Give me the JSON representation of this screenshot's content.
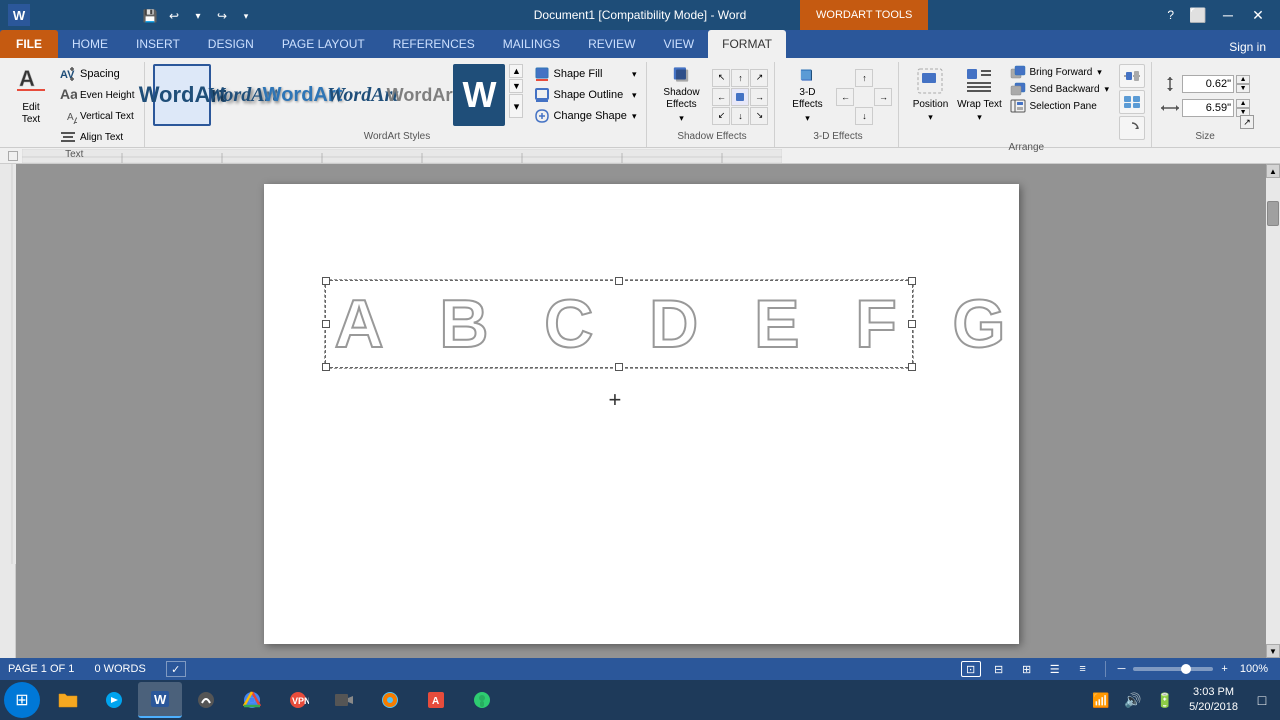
{
  "window": {
    "title": "Document1 [Compatibility Mode] - Word",
    "wordart_tools_label": "WORDART TOOLS",
    "sign_in": "Sign in"
  },
  "title_controls": {
    "help": "?",
    "restore": "❐",
    "minimize": "─",
    "close": "✕"
  },
  "quick_access": {
    "save": "💾",
    "undo": "↩",
    "redo": "↪",
    "more": "▾"
  },
  "ribbon_tabs": {
    "file": "FILE",
    "home": "HOME",
    "insert": "INSERT",
    "design": "DESIGN",
    "page_layout": "PAGE LAYOUT",
    "references": "REFERENCES",
    "mailings": "MAILINGS",
    "review": "REVIEW",
    "view": "VIEW",
    "format": "FORMAT"
  },
  "ribbon": {
    "text_group": {
      "label": "Text",
      "edit_btn": "Edit\nText",
      "spacing_btn": "Spacing",
      "even_btn": "Even Height",
      "vertical_btn": "Vertical\nText",
      "align_btn": "Align\nText"
    },
    "wordart_styles_group": {
      "label": "WordArt Styles",
      "shape_fill": "Shape Fill",
      "shape_outline": "Shape Outline",
      "change_shape": "Change Shape",
      "styles": [
        "WordArt",
        "WordArt",
        "WordArt",
        "WordArt",
        "WordArt",
        "W"
      ]
    },
    "shadow_effects_group": {
      "label": "Shadow Effects",
      "shadow_effects_btn": "Shadow\nEffects"
    },
    "three_d_group": {
      "label": "3-D Effects",
      "three_d_btn": "3-D\nEffects",
      "direction_btns": [
        "",
        "",
        "",
        "",
        ""
      ]
    },
    "arrange_group": {
      "label": "Arrange",
      "position_btn": "Position",
      "wrap_text_btn": "Wrap\nText",
      "bring_forward": "Bring Forward",
      "send_backward": "Send Backward",
      "selection_pane": "Selection Pane",
      "align_btn": "",
      "group_btn": "",
      "rotate_btn": ""
    },
    "size_group": {
      "label": "Size",
      "height_label": "Height:",
      "width_label": "Width:",
      "height_value": "0.62\"",
      "width_value": "6.59\""
    }
  },
  "document": {
    "wordart_text": "A  B  C  D  E  F  G",
    "page_info": "PAGE 1 OF 1",
    "word_count": "0 WORDS"
  },
  "status_bar": {
    "page_info": "PAGE 1 OF 1",
    "word_count": "0 WORDS",
    "zoom": "100%"
  },
  "taskbar": {
    "time": "3:03 PM",
    "date": "5/20/2018"
  }
}
